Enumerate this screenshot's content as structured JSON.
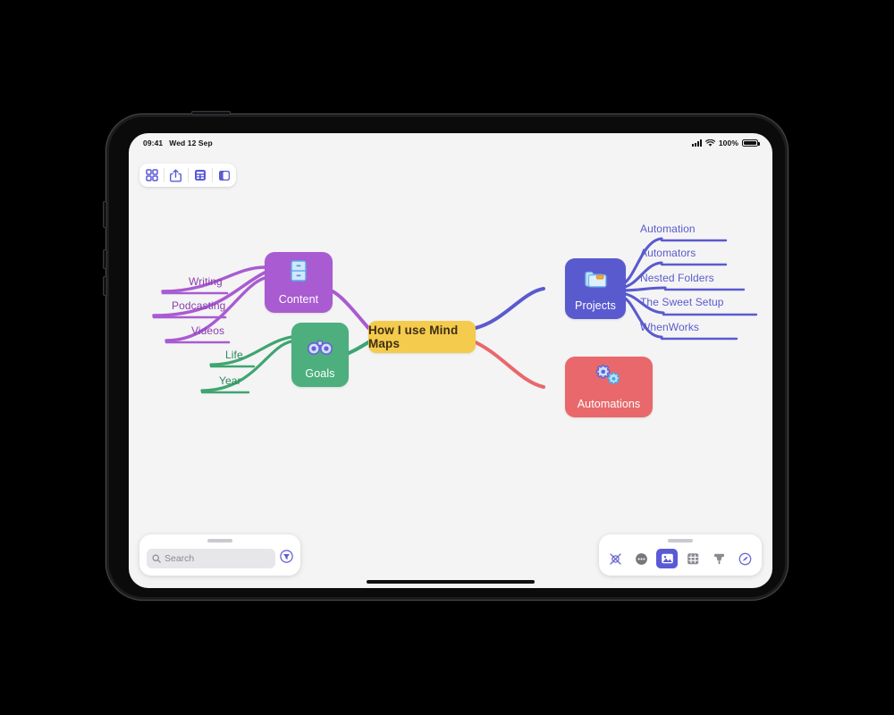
{
  "device": {
    "name": "tablet-device-frame"
  },
  "status_bar": {
    "time": "09:41",
    "date": "Wed 12 Sep",
    "battery_percent": "100%",
    "cellular_icon": "cellular-signal-icon",
    "wifi_icon": "wifi-icon",
    "battery_icon": "battery-icon"
  },
  "top_toolbar": {
    "buttons": [
      {
        "name": "grid-view-button",
        "icon": "grid-icon",
        "label": "Grid"
      },
      {
        "name": "share-button",
        "icon": "share-icon",
        "label": "Share"
      },
      {
        "name": "outline-button",
        "icon": "outline-table-icon",
        "label": "Outline"
      },
      {
        "name": "sidebar-button",
        "icon": "sidebar-icon",
        "label": "Sidebar"
      }
    ]
  },
  "mindmap": {
    "title": "How I use Mind Maps",
    "center": {
      "name": "center-node",
      "label": "How I use Mind Maps",
      "color": "#F5CB4E",
      "text_color": "#3d2f12"
    },
    "branches": [
      {
        "name": "content-branch",
        "label": "Content",
        "color": "#A95BD1",
        "icon": "file-cabinet-icon",
        "leaves": [
          "Writing",
          "Podcasting",
          "Videos"
        ]
      },
      {
        "name": "goals-branch",
        "label": "Goals",
        "color": "#4CAF7D",
        "icon": "binoculars-icon",
        "leaves": [
          "Life",
          "Year"
        ]
      },
      {
        "name": "projects-branch",
        "label": "Projects",
        "color": "#5A5ACF",
        "icon": "folder-icon",
        "leaves": [
          "Automation",
          "Automators",
          "Nested Folders",
          "The Sweet Setup",
          "WhenWorks"
        ]
      },
      {
        "name": "automations-branch",
        "label": "Automations",
        "color": "#E8686B",
        "icon": "gears-icon",
        "leaves": []
      }
    ]
  },
  "search": {
    "name": "search-panel",
    "placeholder": "Search",
    "value": "",
    "icon": "search-icon",
    "filter_icon": "filter-icon"
  },
  "tools": {
    "name": "tools-panel",
    "items": [
      {
        "name": "tool-shape",
        "icon": "shape-icon",
        "selected": false
      },
      {
        "name": "tool-more",
        "icon": "more-circle-icon",
        "selected": false
      },
      {
        "name": "tool-image",
        "icon": "image-icon",
        "selected": true
      },
      {
        "name": "tool-sticker",
        "icon": "sticker-grid-icon",
        "selected": false
      },
      {
        "name": "tool-brush",
        "icon": "brush-icon",
        "selected": false
      },
      {
        "name": "tool-style",
        "icon": "style-circle-icon",
        "selected": false
      }
    ]
  }
}
